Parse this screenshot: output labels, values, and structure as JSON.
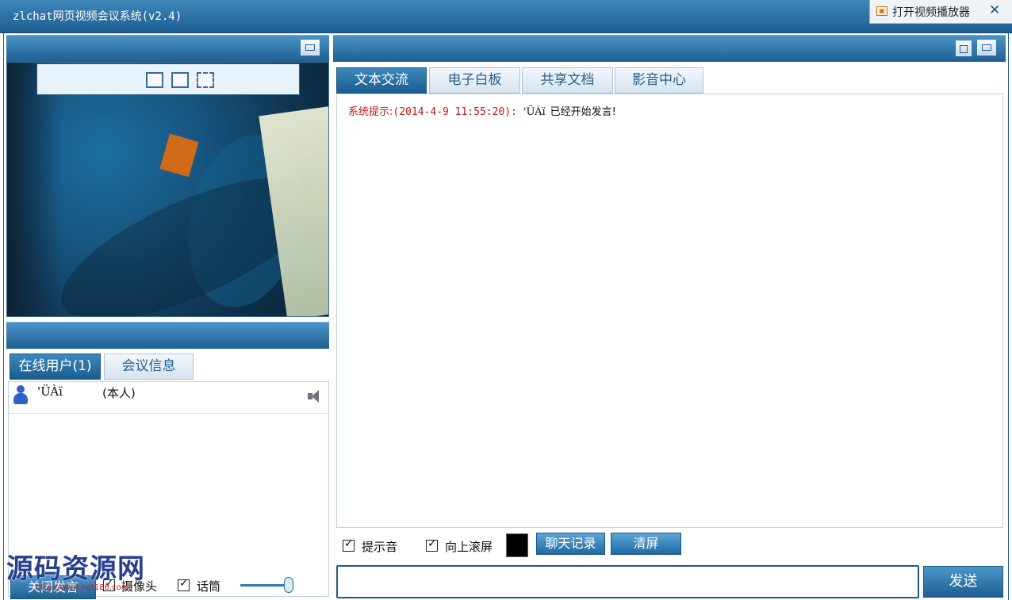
{
  "window": {
    "title": "zlchat网页视频会议系统(v2.4)",
    "open_player_label": "打开视频播放器",
    "close_symbol": "✕"
  },
  "left_tabs": [
    {
      "label": "在线用户(1)",
      "active": true
    },
    {
      "label": "会议信息",
      "active": false
    }
  ],
  "online_users": [
    {
      "name": "'ÜÀï",
      "self_label": "(本人)"
    }
  ],
  "bottom_controls": {
    "close_speak_label": "关闭发言",
    "camera_label": "摄像头",
    "mic_label": "话筒",
    "volume_percent": 92
  },
  "right_tabs": [
    {
      "label": "文本交流",
      "active": true
    },
    {
      "label": "电子白板",
      "active": false
    },
    {
      "label": "共享文档",
      "active": false
    },
    {
      "label": "影音中心",
      "active": false
    }
  ],
  "system_message": {
    "label": "系统提示:",
    "time": "(2014-4-9 11:55:20):",
    "user": "'ÜÀï",
    "text": "已经开始发言!"
  },
  "chat_tools": {
    "sound_label": "提示音",
    "scroll_label": "向上滚屏",
    "history_label": "聊天记录",
    "clear_label": "清屏",
    "text_color": "#000000"
  },
  "send_label": "发送",
  "watermark": {
    "text": "源码资源网",
    "url": "http://www.net188.com"
  },
  "colors": {
    "header_blue": "#1f5f92",
    "tab_active": "#2f78b0",
    "system_red": "#c01818"
  }
}
